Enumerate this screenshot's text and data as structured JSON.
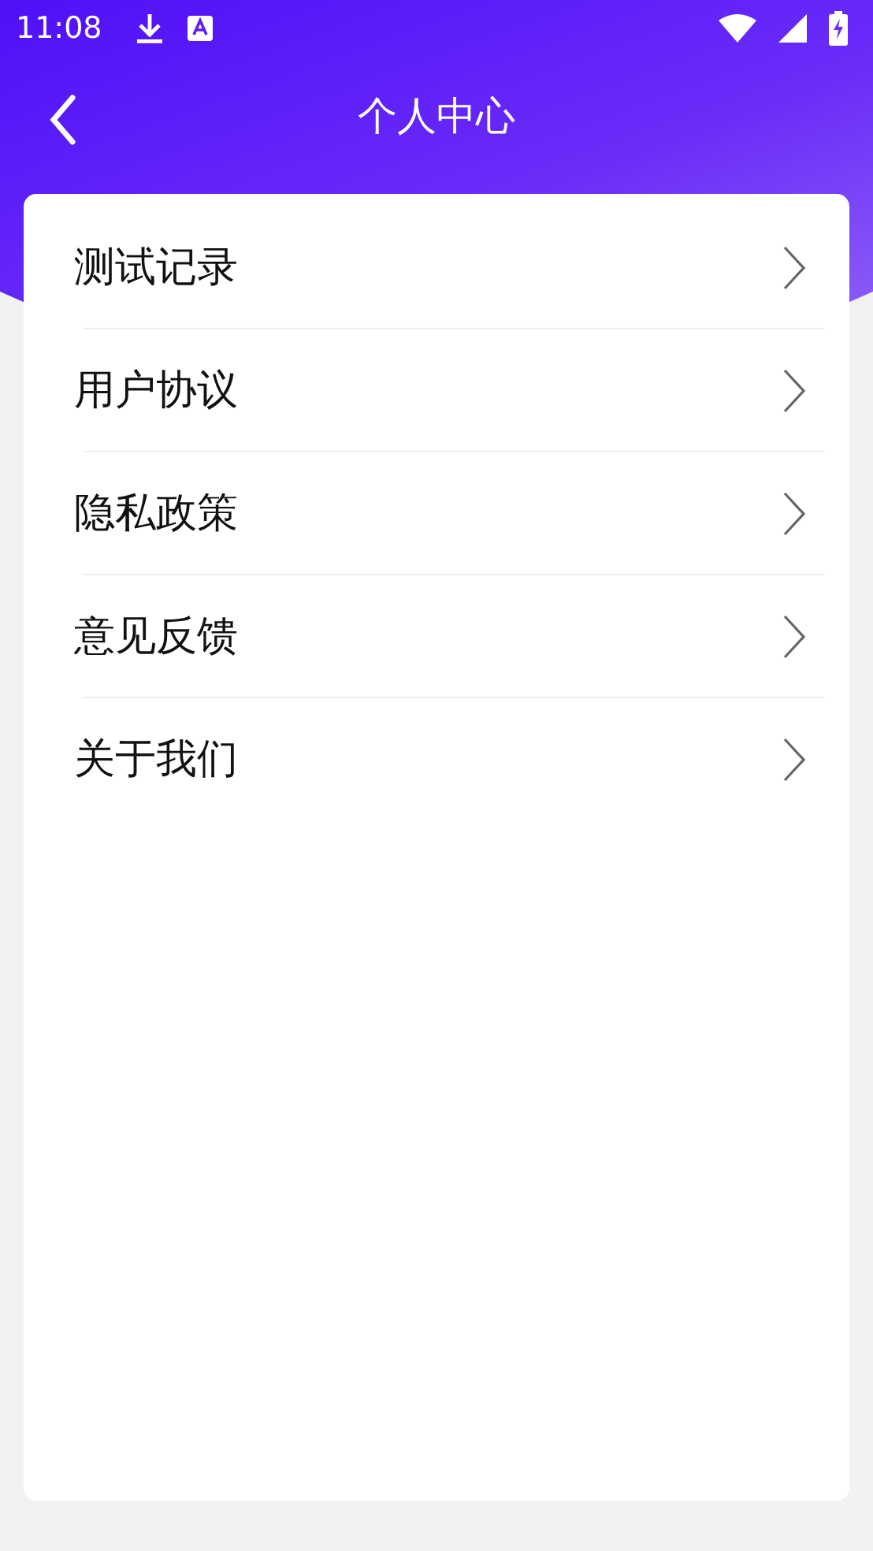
{
  "status_bar": {
    "time": "11:08"
  },
  "header": {
    "title": "个人中心"
  },
  "menu": {
    "items": [
      {
        "label": "测试记录"
      },
      {
        "label": "用户协议"
      },
      {
        "label": "隐私政策"
      },
      {
        "label": "意见反馈"
      },
      {
        "label": "关于我们"
      }
    ]
  }
}
